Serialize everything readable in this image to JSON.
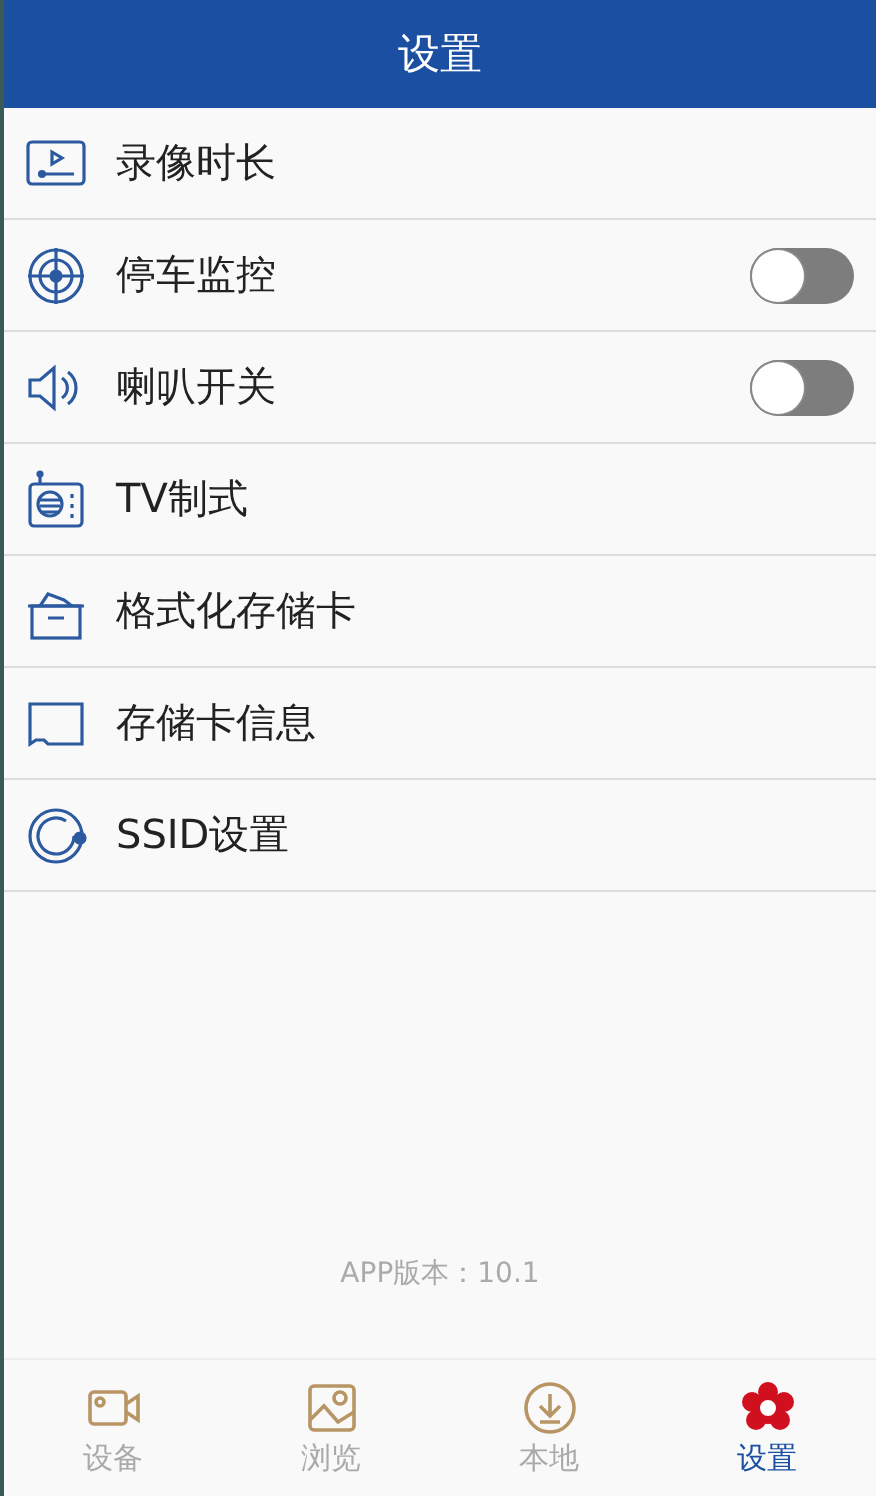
{
  "header": {
    "title": "设置"
  },
  "items": [
    {
      "label": "录像时长",
      "kind": "plain"
    },
    {
      "label": "停车监控",
      "kind": "toggle",
      "on": false
    },
    {
      "label": "喇叭开关",
      "kind": "toggle",
      "on": false
    },
    {
      "label": "TV制式",
      "kind": "plain"
    },
    {
      "label": "格式化存储卡",
      "kind": "plain"
    },
    {
      "label": "存储卡信息",
      "kind": "plain"
    },
    {
      "label": "SSID设置",
      "kind": "plain"
    }
  ],
  "version": "APP版本：10.1",
  "tabs": [
    {
      "label": "设备",
      "selected": false
    },
    {
      "label": "浏览",
      "selected": false
    },
    {
      "label": "本地",
      "selected": false
    },
    {
      "label": "设置",
      "selected": true
    }
  ]
}
